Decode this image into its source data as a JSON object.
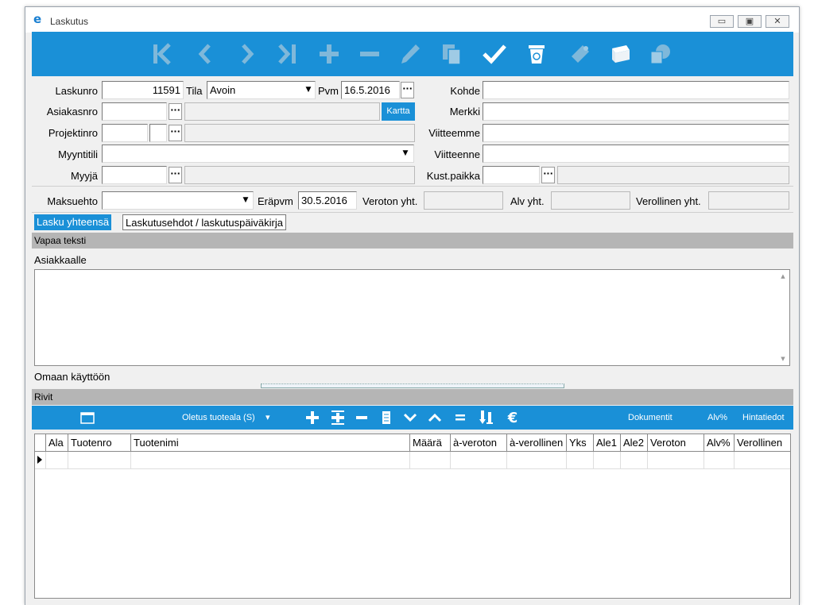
{
  "window": {
    "title": "Laskutus",
    "app_icon_glyph": "e",
    "controls": {
      "minimize": "▭",
      "restore": "▣",
      "close": "✕"
    }
  },
  "toolbar": {
    "icons": [
      "first-record-icon",
      "previous-record-icon",
      "next-record-icon",
      "last-record-icon",
      "add-icon",
      "remove-icon",
      "edit-pencil-icon",
      "copy-icon",
      "confirm-check-icon",
      "recycle-bin-icon",
      "flashlight-icon",
      "printer-icon",
      "globe-document-icon"
    ],
    "accent": "#1a90d7"
  },
  "form": {
    "laskunro": {
      "label": "Laskunro",
      "value": "11591"
    },
    "tila": {
      "label": "Tila",
      "value": "Avoin"
    },
    "pvm": {
      "label": "Pvm",
      "value": "16.5.2016"
    },
    "kohde": {
      "label": "Kohde",
      "value": ""
    },
    "asiakasnro": {
      "label": "Asiakasnro",
      "value": ""
    },
    "kartta": "Kartta",
    "merkki": {
      "label": "Merkki",
      "value": ""
    },
    "projektinro": {
      "label": "Projektinro",
      "value": ""
    },
    "viitteemme": {
      "label": "Viitteemme",
      "value": ""
    },
    "myyntitili": {
      "label": "Myyntitili",
      "value": ""
    },
    "viitteenne": {
      "label": "Viitteenne",
      "value": ""
    },
    "myyja": {
      "label": "Myyjä",
      "value": ""
    },
    "kustpaikka": {
      "label": "Kust.paikka",
      "value": ""
    },
    "maksuehto": {
      "label": "Maksuehto",
      "value": ""
    },
    "erapvm": {
      "label": "Eräpvm",
      "value": "30.5.2016"
    },
    "veroton_yht": {
      "label": "Veroton yht.",
      "value": ""
    },
    "alv_yht": {
      "label": "Alv yht.",
      "value": ""
    },
    "verollinen_yht": {
      "label": "Verollinen yht.",
      "value": ""
    },
    "dots": "···"
  },
  "tabs": [
    {
      "label": "Lasku yhteensä",
      "active": true
    },
    {
      "label": "Laskutusehdot / laskutuspäiväkirja",
      "active": false
    }
  ],
  "sections": {
    "vapaa_teksti": "Vapaa teksti",
    "asiakkaalle": "Asiakkaalle",
    "omaan_kayttoon": "Omaan käyttöön",
    "rivit": "Rivit"
  },
  "rows_toolbar": {
    "oletus": "Oletus tuoteala (S)",
    "dropdown_glyph": "▾",
    "dokumentit": "Dokumentit",
    "alv": "Alv%",
    "hintatiedot": "Hintatiedot",
    "icons": [
      "window-icon",
      "add-row-icon",
      "insert-row-icon",
      "remove-row-icon",
      "document-icon",
      "move-down-icon",
      "move-up-icon",
      "equals-icon",
      "sort-down-icon",
      "euro-icon"
    ]
  },
  "grid": {
    "columns": [
      "",
      "Ala",
      "Tuotenro",
      "Tuotenimi",
      "Määrä",
      "à-veroton",
      "à-verollinen",
      "Yks",
      "Ale1",
      "Ale2",
      "Veroton",
      "Alv%",
      "Verollinen"
    ]
  }
}
